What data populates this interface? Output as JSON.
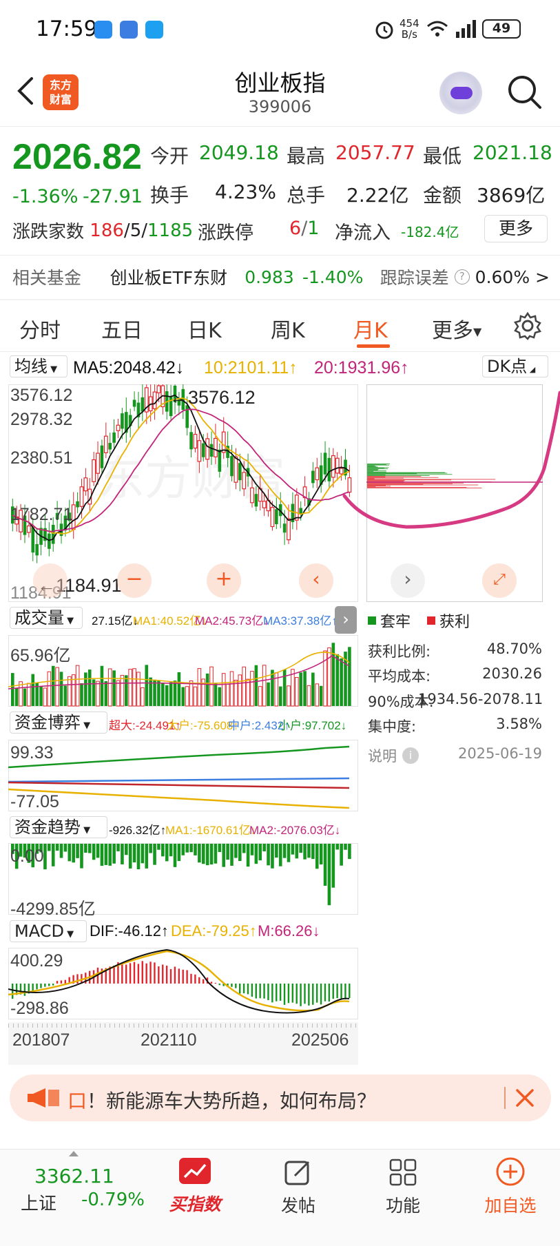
{
  "status_bar": {
    "time": "17:59",
    "net_speed_value": "454",
    "net_speed_unit": "B/s",
    "battery": "49",
    "icons": [
      "weather-icon",
      "game-icon",
      "search-app-icon",
      "alarm-icon",
      "wifi-icon",
      "signal-icon",
      "battery-icon"
    ]
  },
  "header": {
    "back_icon": "chevron-left-icon",
    "logo_line1": "东方",
    "logo_line2": "财富",
    "title": "创业板指",
    "code": "399006",
    "search_icon": "search-icon"
  },
  "quote": {
    "price": "2026.82",
    "change_pct": "-1.36%",
    "change_abs": "-27.91",
    "open_label": "今开",
    "open": "2049.18",
    "high_label": "最高",
    "high": "2057.77",
    "low_label": "最低",
    "low": "2021.18",
    "turnover_label": "换手",
    "turnover": "4.23%",
    "volume_label": "总手",
    "volume": "2.22亿",
    "amount_label": "金额",
    "amount": "3869亿",
    "breadth_label": "涨跌家数",
    "up_count": "186",
    "flat_count": "5",
    "down_count": "1185",
    "sep": "/",
    "limit_label": "涨跌停",
    "limit_up": "6",
    "limit_down": "1",
    "netflow_label": "净流入",
    "netflow": "-182.4亿",
    "more_label": "更多"
  },
  "fund": {
    "label": "相关基金",
    "name": "创业板ETF东财",
    "price": "0.983",
    "change": "-1.40%",
    "tracking_label": "跟踪误差",
    "tracking": "0.60%",
    "arrow": ">"
  },
  "tabs": [
    {
      "label": "分时",
      "active": false
    },
    {
      "label": "五日",
      "active": false
    },
    {
      "label": "日K",
      "active": false
    },
    {
      "label": "周K",
      "active": false
    },
    {
      "label": "月K",
      "active": true
    },
    {
      "label": "更多",
      "active": false
    }
  ],
  "kline": {
    "ma_selector": "均线",
    "ma5": "MA5:2048.42↓",
    "ma10": "10:2101.11↑",
    "ma20": "20:1931.96↑",
    "dk_label": "DK点",
    "price_ticks": [
      "3576.12",
      "2978.32",
      "2380.51",
      "1782.71",
      "1184.91"
    ],
    "max_label": "3576.12",
    "min_label": "1184.91",
    "watermark": "东方财富",
    "dates": [
      "201807",
      "202110",
      "202506"
    ]
  },
  "volume": {
    "selector": "成交量",
    "cur": "27.15亿↓",
    "ma1": "MA1:40.52亿↓",
    "ma2": "MA2:45.73亿↓",
    "ma3": "MA3:37.38亿↑",
    "top_label": "65.96亿"
  },
  "fund_game": {
    "selector": "资金博弈",
    "super_large": "超大:-24.491↑",
    "large": "大户:-75.608↑",
    "medium": "中户:2.432↑",
    "small": "小户:97.702↓",
    "top_label": "99.33",
    "bottom_label": "-77.05"
  },
  "fund_trend": {
    "selector": "资金趋势",
    "cur": "-926.32亿↑",
    "ma1": "MA1:-1670.61亿↓",
    "ma2": "MA2:-2076.03亿↓",
    "top_label": "0.00",
    "bottom_label": "-4299.85亿"
  },
  "macd": {
    "selector": "MACD",
    "dif": "DIF:-46.12↑",
    "dea": "DEA:-79.25↑",
    "m": "M:66.26↓",
    "top_label": "400.29",
    "bottom_label": "-298.86"
  },
  "chips": {
    "legend_trapped": "套牢",
    "legend_profit": "获利",
    "profit_ratio_label": "获利比例:",
    "profit_ratio": "48.70%",
    "avg_cost_label": "平均成本:",
    "avg_cost": "2030.26",
    "cost90_label": "90%成本:",
    "cost90": "1934.56-2078.11",
    "concentration_label": "集中度:",
    "concentration": "3.58%",
    "note_label": "说明",
    "date": "2025-06-19"
  },
  "banner": {
    "text": "！新能源车大势所趋，如何布局？",
    "close_icon": "close-icon"
  },
  "bottom_bar": {
    "sh_price": "3362.11",
    "sh_label": "上证",
    "sh_change": "-0.79%",
    "buy_index": "买指数",
    "post": "发帖",
    "func": "功能",
    "add_watch": "加自选"
  },
  "colors": {
    "up": "#e0262c",
    "down": "#15961f",
    "accent": "#f05a22",
    "ma5": "#111111",
    "ma10": "#e8b100",
    "ma20": "#c2247a"
  }
}
